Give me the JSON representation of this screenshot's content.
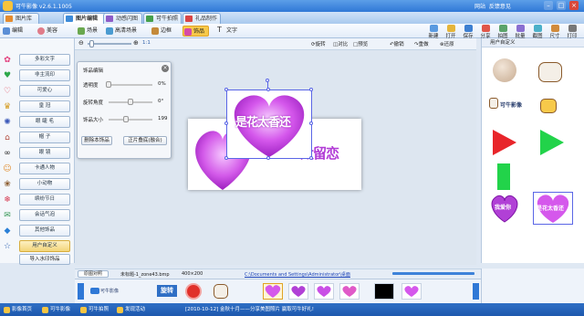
{
  "app": {
    "title": "可牛影像 v2.6.1.1005",
    "links": [
      "网站",
      "反馈意见"
    ],
    "min": "–",
    "max": "□",
    "close": "×"
  },
  "main_tabs": [
    {
      "label": "图片库"
    },
    {
      "label": "图片编辑"
    },
    {
      "label": "动感闪图"
    },
    {
      "label": "可牛拍照"
    },
    {
      "label": "礼品制作"
    }
  ],
  "tools": [
    {
      "label": "编辑"
    },
    {
      "label": "美容"
    },
    {
      "label": "场景"
    },
    {
      "label": "高清场景"
    },
    {
      "label": "边框"
    },
    {
      "label": "饰品"
    },
    {
      "label": "文字"
    }
  ],
  "right_tools": [
    "新建",
    "打开",
    "保存",
    "分享",
    "拍图",
    "批量",
    "截图",
    "尺寸",
    "打印"
  ],
  "canvas_bar": {
    "zoom_ratio": "1:1",
    "actions": [
      "旋转",
      "对比",
      "预览",
      "撤销",
      "重做",
      "还原"
    ]
  },
  "left_items": [
    {
      "label": "多彩文字",
      "icon": "✿"
    },
    {
      "label": "非主流印",
      "icon": "♥"
    },
    {
      "label": "可爱心",
      "icon": "♡"
    },
    {
      "label": "皇 冠",
      "icon": "♛"
    },
    {
      "label": "眼 睫 毛",
      "icon": "✺"
    },
    {
      "label": "帽 子",
      "icon": "⌂"
    },
    {
      "label": "眼 镜",
      "icon": "∞"
    },
    {
      "label": "卡通人物",
      "icon": "☺"
    },
    {
      "label": "小动物",
      "icon": "❀"
    },
    {
      "label": "缤纷节日",
      "icon": "❄"
    },
    {
      "label": "会话气泡",
      "icon": "✉"
    },
    {
      "label": "其他饰品",
      "icon": "◆"
    },
    {
      "label": "用户自定义",
      "icon": "☆"
    }
  ],
  "import_button": "导入水印饰品",
  "props_panel": {
    "title": "饰品编辑",
    "rows": [
      {
        "label": "透明度",
        "value": "0%",
        "level": 0.0
      },
      {
        "label": "旋转角度",
        "value": "0°",
        "level": 0.5
      },
      {
        "label": "饰品大小",
        "value": "199",
        "level": 0.4
      }
    ],
    "delete_button": "删除本饰品",
    "merge_button": "正片叠底(融合)"
  },
  "sticker_text": "是花太香还",
  "photo_text": "太留恋",
  "right_panel": {
    "title": "用户自定义",
    "caption": "可牛影像",
    "big_heart_text": "是花太香还",
    "small_heart_text": "我爱你"
  },
  "status": {
    "tab": "原图对照",
    "filename": "未标题-1_zone43.bmp",
    "dimensions": "400×200",
    "path": "C:\\Documents and Settings\\Administrator\\桌面"
  },
  "strip": {
    "rotate_label": "旋转",
    "logo_label": "可牛影像"
  },
  "bottom_bar": {
    "items": [
      "影像首页",
      "可牛影像",
      "可牛拍照",
      "发现活动"
    ],
    "news": "[2010-10-12] 金秋十月——分享美图照片 赢取可牛好礼!"
  },
  "colors": {
    "accent": "#2f78d6",
    "active_tool": "#f7c94a",
    "heart": "#c94fe6",
    "green_flag": "#22d34a",
    "red_flag": "#e8252a"
  }
}
